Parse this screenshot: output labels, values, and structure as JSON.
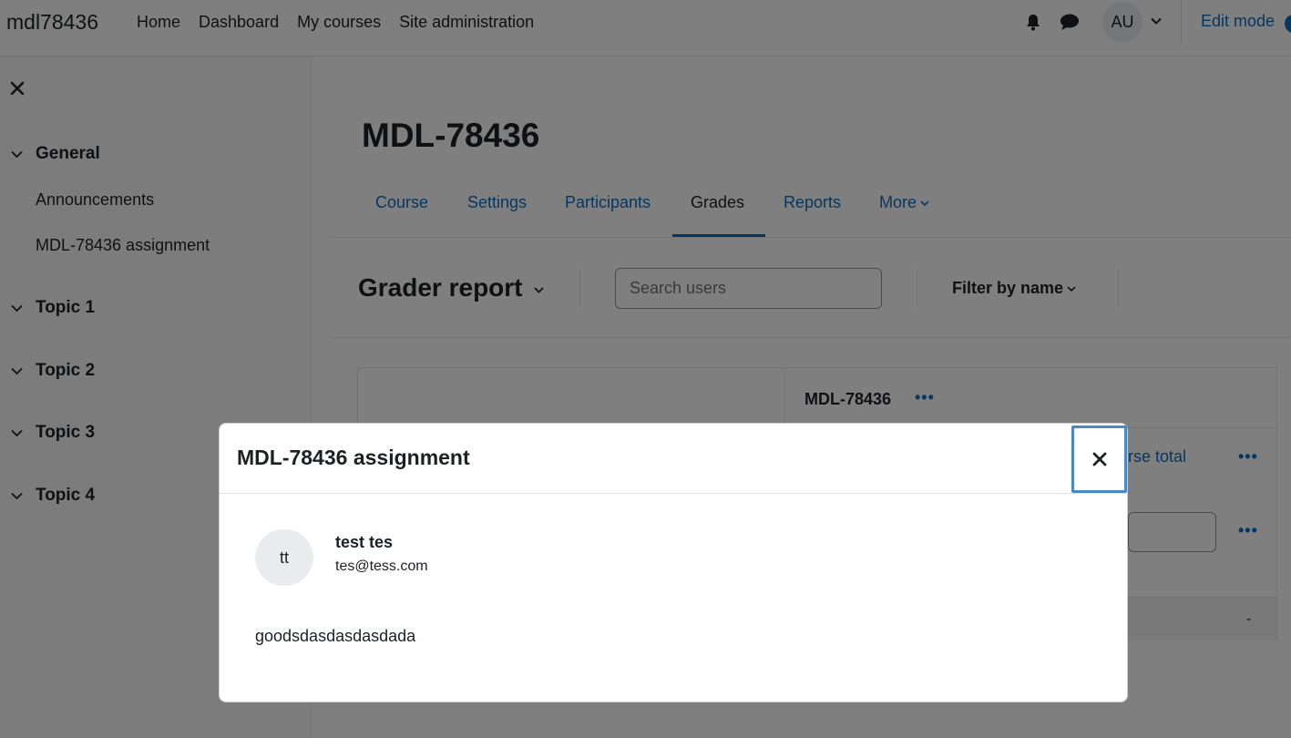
{
  "navbar": {
    "brand": "mdl78436",
    "items": [
      "Home",
      "Dashboard",
      "My courses",
      "Site administration"
    ],
    "user_initials": "AU",
    "edit_mode_label": "Edit mode",
    "icons": [
      "bell-icon",
      "chat-icon",
      "chevron-down-icon"
    ]
  },
  "drawer": {
    "sections": [
      {
        "title": "General",
        "items": [
          "Announcements",
          "MDL-78436 assignment"
        ]
      },
      {
        "title": "Topic 1",
        "items": []
      },
      {
        "title": "Topic 2",
        "items": []
      },
      {
        "title": "Topic 3",
        "items": []
      },
      {
        "title": "Topic 4",
        "items": []
      }
    ]
  },
  "page": {
    "title": "MDL-78436",
    "tabs": [
      "Course",
      "Settings",
      "Participants",
      "Grades",
      "Reports",
      "More"
    ],
    "active_tab": "Grades"
  },
  "grader": {
    "title": "Grader report",
    "search_placeholder": "Search users",
    "filter_label": "Filter by name",
    "course_header": "MDL-78436",
    "course_total_partial": "rse total",
    "empty_value": "-"
  },
  "modal": {
    "title": "MDL-78436 assignment",
    "user_initials": "tt",
    "user_name": "test tes",
    "user_email": "tes@tess.com",
    "feedback": "goodsdasdasdasdada"
  },
  "colors": {
    "link": "#0f6cbf",
    "text": "#1d2125",
    "focus_ring": "#4a89c7"
  }
}
